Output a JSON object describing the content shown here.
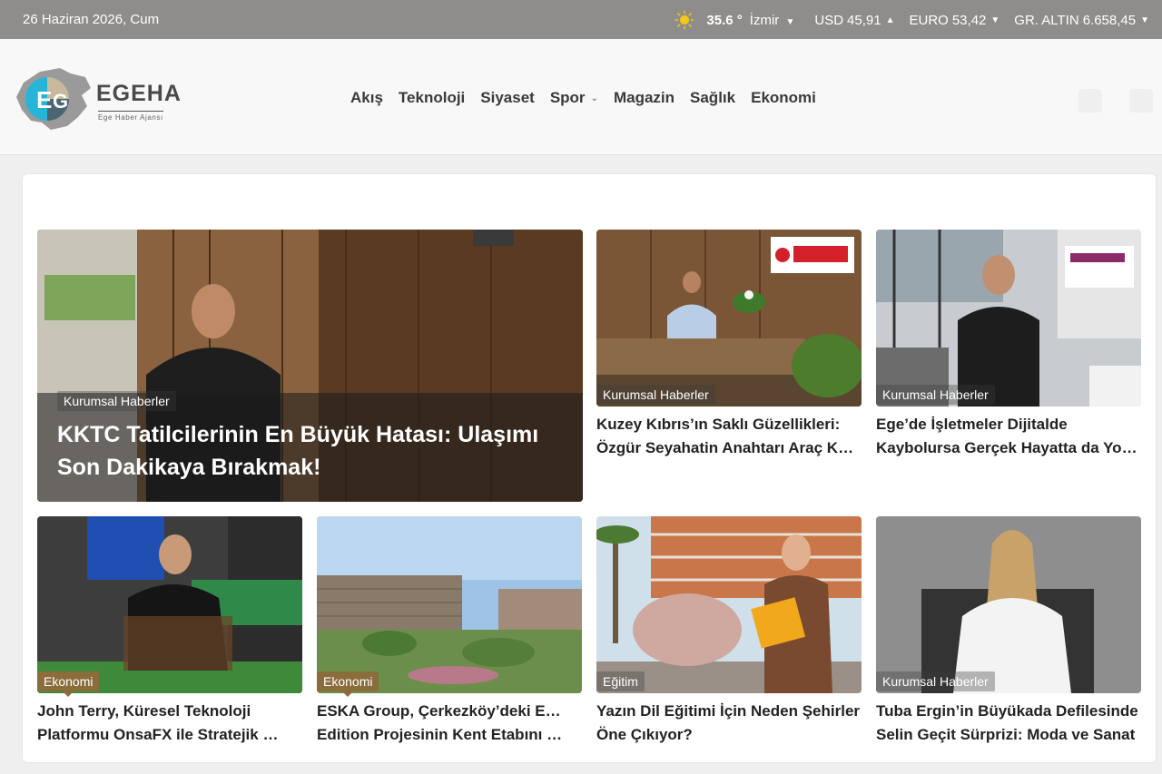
{
  "topbar": {
    "date": "26 Haziran 2026, Cum",
    "weather": {
      "icon": "sun-icon",
      "temperature": "35.6 °",
      "city": "İzmir"
    },
    "currencies": [
      {
        "label": "USD",
        "value": "45,91",
        "trend": "up"
      },
      {
        "label": "EURO",
        "value": "53,42",
        "trend": "down"
      },
      {
        "label": "GR. ALTIN",
        "value": "6.658,45",
        "trend": "down"
      }
    ]
  },
  "header": {
    "logo": {
      "brand": "EGEHA",
      "slogan": "Ege Haber Ajansı"
    },
    "menu": [
      {
        "label": "Akış"
      },
      {
        "label": "Teknoloji"
      },
      {
        "label": "Siyaset"
      },
      {
        "label": "Spor",
        "has_dropdown": true
      },
      {
        "label": "Magazin"
      },
      {
        "label": "Sağlık"
      },
      {
        "label": "Ekonomi"
      }
    ]
  },
  "featured": {
    "category": "Kurumsal Haberler",
    "title_lines": [
      "KKTC Tatilcilerinin En Büyük Hatası: Ulaşımı",
      "Son Dakikaya Bırakmak!"
    ]
  },
  "articles": [
    {
      "category": "Kurumsal Haberler",
      "title_lines": [
        "Kuzey Kıbrıs’ın Saklı Güzellikleri:",
        "Özgür Seyahatin Anahtarı Araç Kiralama"
      ]
    },
    {
      "category": "Kurumsal Haberler",
      "title_lines": [
        "Ege’de İşletmeler Dijitalde",
        "Kaybolursa Gerçek Hayatta da Yok Olur"
      ]
    },
    {
      "category": "Ekonomi",
      "title_lines": [
        "John Terry, Küresel Teknoloji",
        "Platformu OnsaFX ile Stratejik Ortaklık"
      ]
    },
    {
      "category": "Ekonomi",
      "title_lines": [
        "ESKA Group, Çerkezköy’deki Eska",
        "Edition Projesinin Kent Etabını Tanıttı"
      ]
    },
    {
      "category": "Eğitim",
      "title_lines": [
        "Yazın Dil Eğitimi İçin Neden Şehirler",
        "Öne Çıkıyor?"
      ]
    },
    {
      "category": "Kurumsal Haberler",
      "title_lines": [
        "Tuba Ergin’in Büyükada Defilesinde",
        "Selin Geçit Sürprizi: Moda ve Sanat"
      ]
    }
  ]
}
